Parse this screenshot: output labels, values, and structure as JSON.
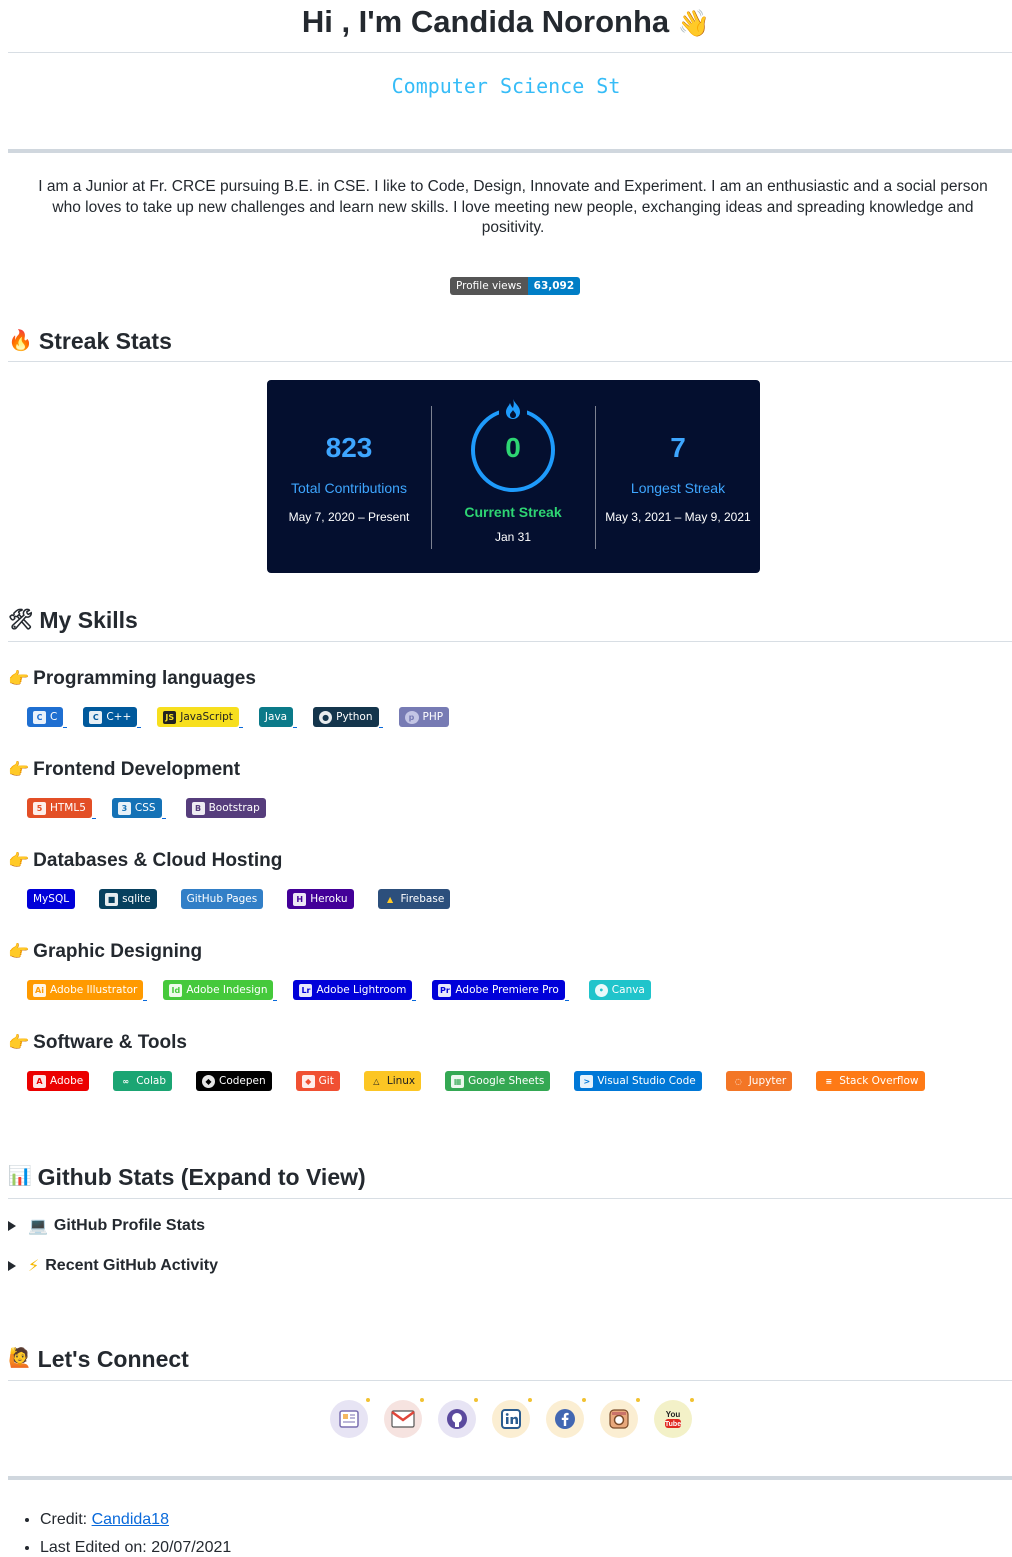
{
  "header": {
    "title": "Hi , I'm Candida Noronha",
    "wave_icon": "waving-hand-icon",
    "typing_text": "Computer Science St"
  },
  "about": "I am a Junior at Fr. CRCE pursuing B.E. in CSE. I like to Code, Design, Innovate and Experiment. I am an enthusiastic and a social person who loves to take up new challenges and learn new skills. I love meeting new people, exchanging ideas and spreading knowledge and positivity.",
  "profile_views": {
    "label": "Profile views",
    "count": "63,092"
  },
  "streak": {
    "heading": "Streak Stats",
    "total": {
      "value": "823",
      "label": "Total Contributions",
      "range": "May 7, 2020 – Present"
    },
    "current": {
      "value": "0",
      "label": "Current Streak",
      "date": "Jan 31"
    },
    "longest": {
      "value": "7",
      "label": "Longest Streak",
      "range": "May 3, 2021 – May 9, 2021"
    },
    "colors": {
      "bg": "#040f2f",
      "accent": "#3ea6ff",
      "current": "#2ed573"
    }
  },
  "skills": {
    "heading": "My Skills",
    "programming": {
      "title": "Programming languages",
      "badges": [
        {
          "label": "C",
          "color": "#1f6fd1"
        },
        {
          "label": "C++",
          "color": "#00599c"
        },
        {
          "label": "JavaScript",
          "color": "#f7df1e"
        },
        {
          "label": "Java",
          "color": "#0b7a89"
        },
        {
          "label": "Python",
          "color": "#14354c"
        },
        {
          "label": "PHP",
          "color": "#777bb4"
        }
      ]
    },
    "frontend": {
      "title": "Frontend Development",
      "badges": [
        {
          "label": "HTML5",
          "color": "#e34f26"
        },
        {
          "label": "CSS",
          "color": "#1572b6"
        },
        {
          "label": "Bootstrap",
          "color": "#563d7c"
        }
      ]
    },
    "databases": {
      "title": "Databases & Cloud Hosting",
      "badges": [
        {
          "label": "MySQL",
          "color": "#0000d9"
        },
        {
          "label": "sqlite",
          "color": "#07405e"
        },
        {
          "label": "GitHub Pages",
          "color": "#327fc7"
        },
        {
          "label": "Heroku",
          "color": "#430098"
        },
        {
          "label": "Firebase",
          "color": "#2c4f7c"
        }
      ]
    },
    "graphic": {
      "title": "Graphic Designing",
      "badges": [
        {
          "label": "Adobe Illustrator",
          "color": "#ff9a00"
        },
        {
          "label": "Adobe Indesign",
          "color": "#45c93b"
        },
        {
          "label": "Adobe Lightroom",
          "color": "#0000d9"
        },
        {
          "label": "Adobe Premiere Pro",
          "color": "#0000d9"
        },
        {
          "label": "Canva",
          "color": "#20c4cb"
        }
      ]
    },
    "software": {
      "title": "Software & Tools",
      "badges": [
        {
          "label": "Adobe",
          "color": "#eb0000"
        },
        {
          "label": "Colab",
          "color": "#1ba573"
        },
        {
          "label": "Codepen",
          "color": "#000000"
        },
        {
          "label": "Git",
          "color": "#f05032"
        },
        {
          "label": "Linux",
          "color": "#fcc624"
        },
        {
          "label": "Google Sheets",
          "color": "#34a853"
        },
        {
          "label": "Visual Studio Code",
          "color": "#0078d7"
        },
        {
          "label": "Jupyter",
          "color": "#f37626"
        },
        {
          "label": "Stack Overflow",
          "color": "#fe7a16"
        }
      ]
    }
  },
  "github_stats": {
    "heading": "Github Stats (Expand to View)",
    "items": [
      {
        "label": "GitHub Profile Stats",
        "icon": "laptop-icon"
      },
      {
        "label": "Recent GitHub Activity",
        "icon": "lightning-icon"
      }
    ]
  },
  "connect": {
    "heading": "Let's Connect",
    "icons": [
      "portfolio-icon",
      "gmail-icon",
      "github-icon",
      "linkedin-icon",
      "facebook-icon",
      "instagram-icon",
      "youtube-icon"
    ]
  },
  "footer": {
    "credit_label": "Credit:",
    "credit_link": "Candida18",
    "edited": "Last Edited on: 20/07/2021"
  }
}
